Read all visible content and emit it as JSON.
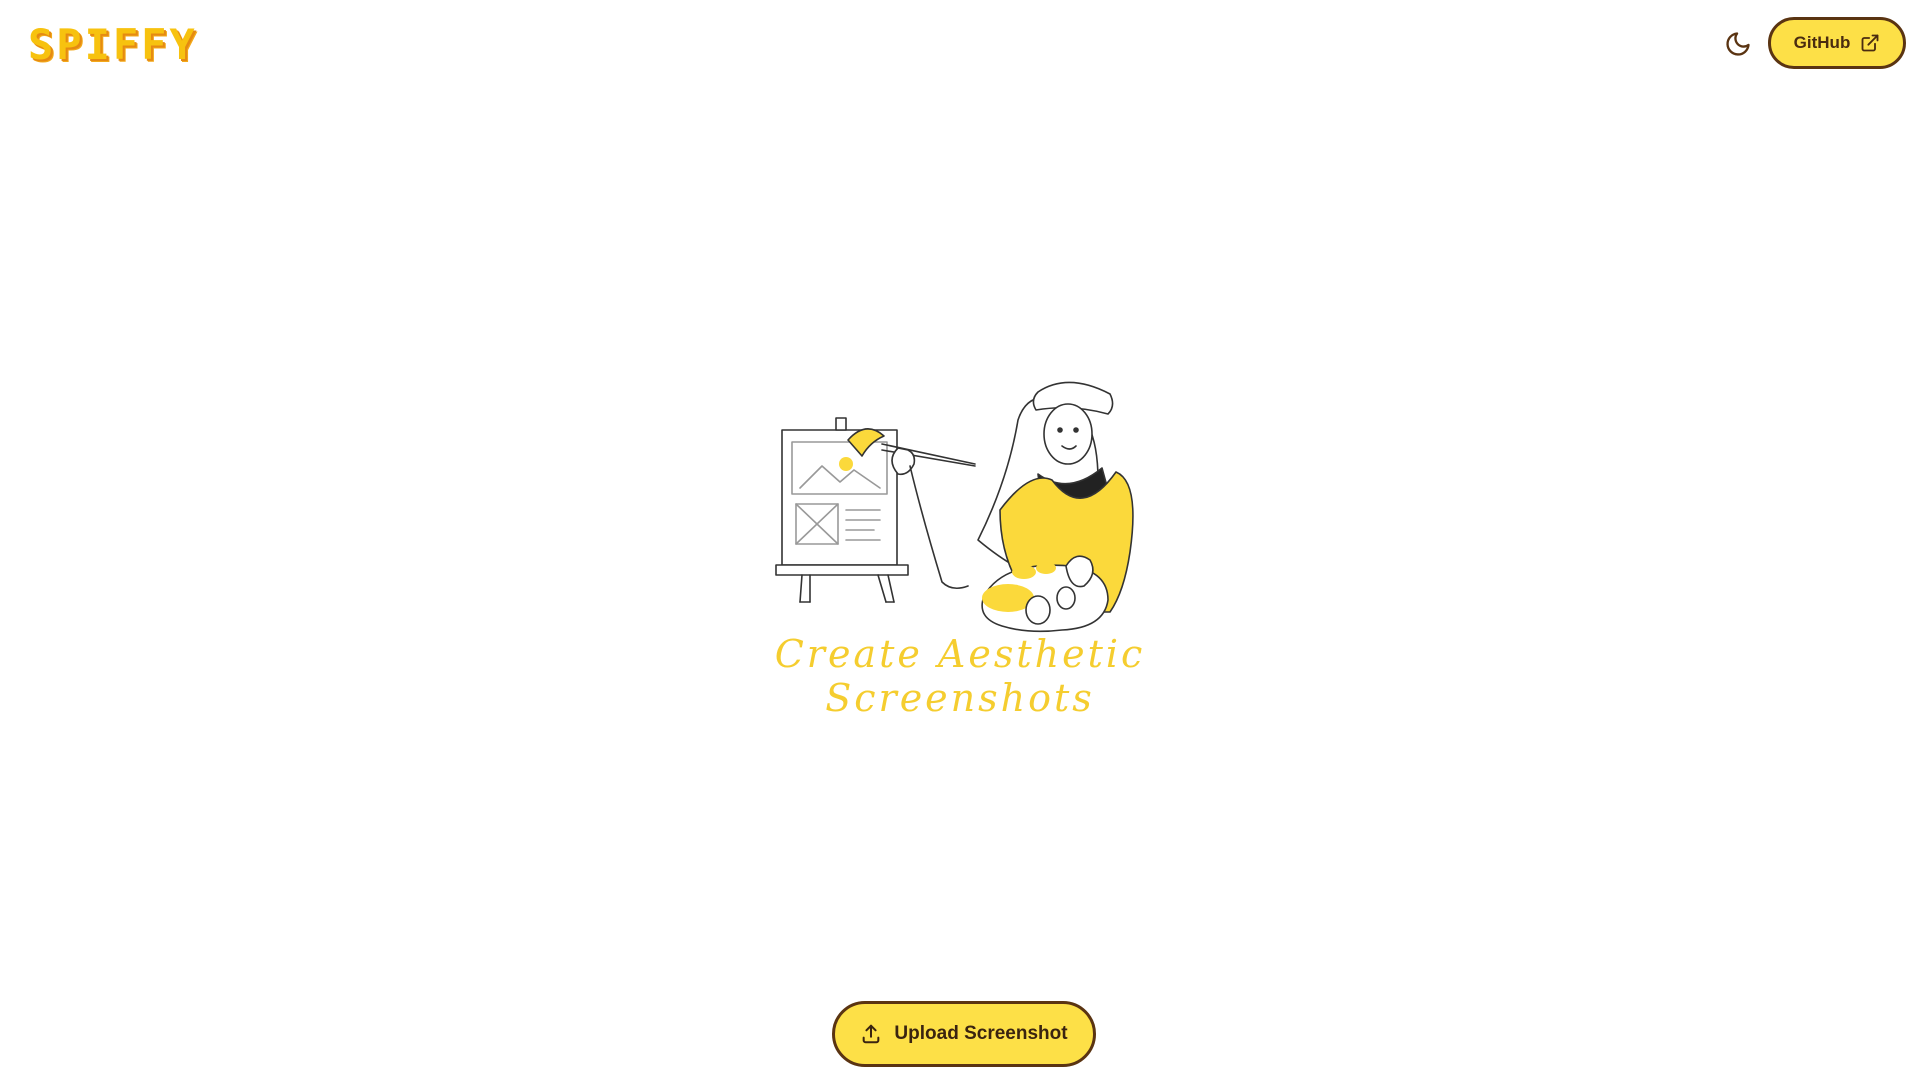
{
  "header": {
    "logo_text": "SPIFFY",
    "theme_toggle_icon": "moon-icon",
    "github_label": "GitHub",
    "github_icon": "external-link-icon"
  },
  "hero": {
    "illustration": "painter-at-easel-illustration",
    "tagline": "Create Aesthetic Screenshots"
  },
  "upload": {
    "label": "Upload Screenshot",
    "icon": "upload-icon"
  },
  "colors": {
    "accent": "#fde047",
    "border": "#5a3412",
    "tagline": "#f5cd2f",
    "logo": "#f7c20f"
  }
}
